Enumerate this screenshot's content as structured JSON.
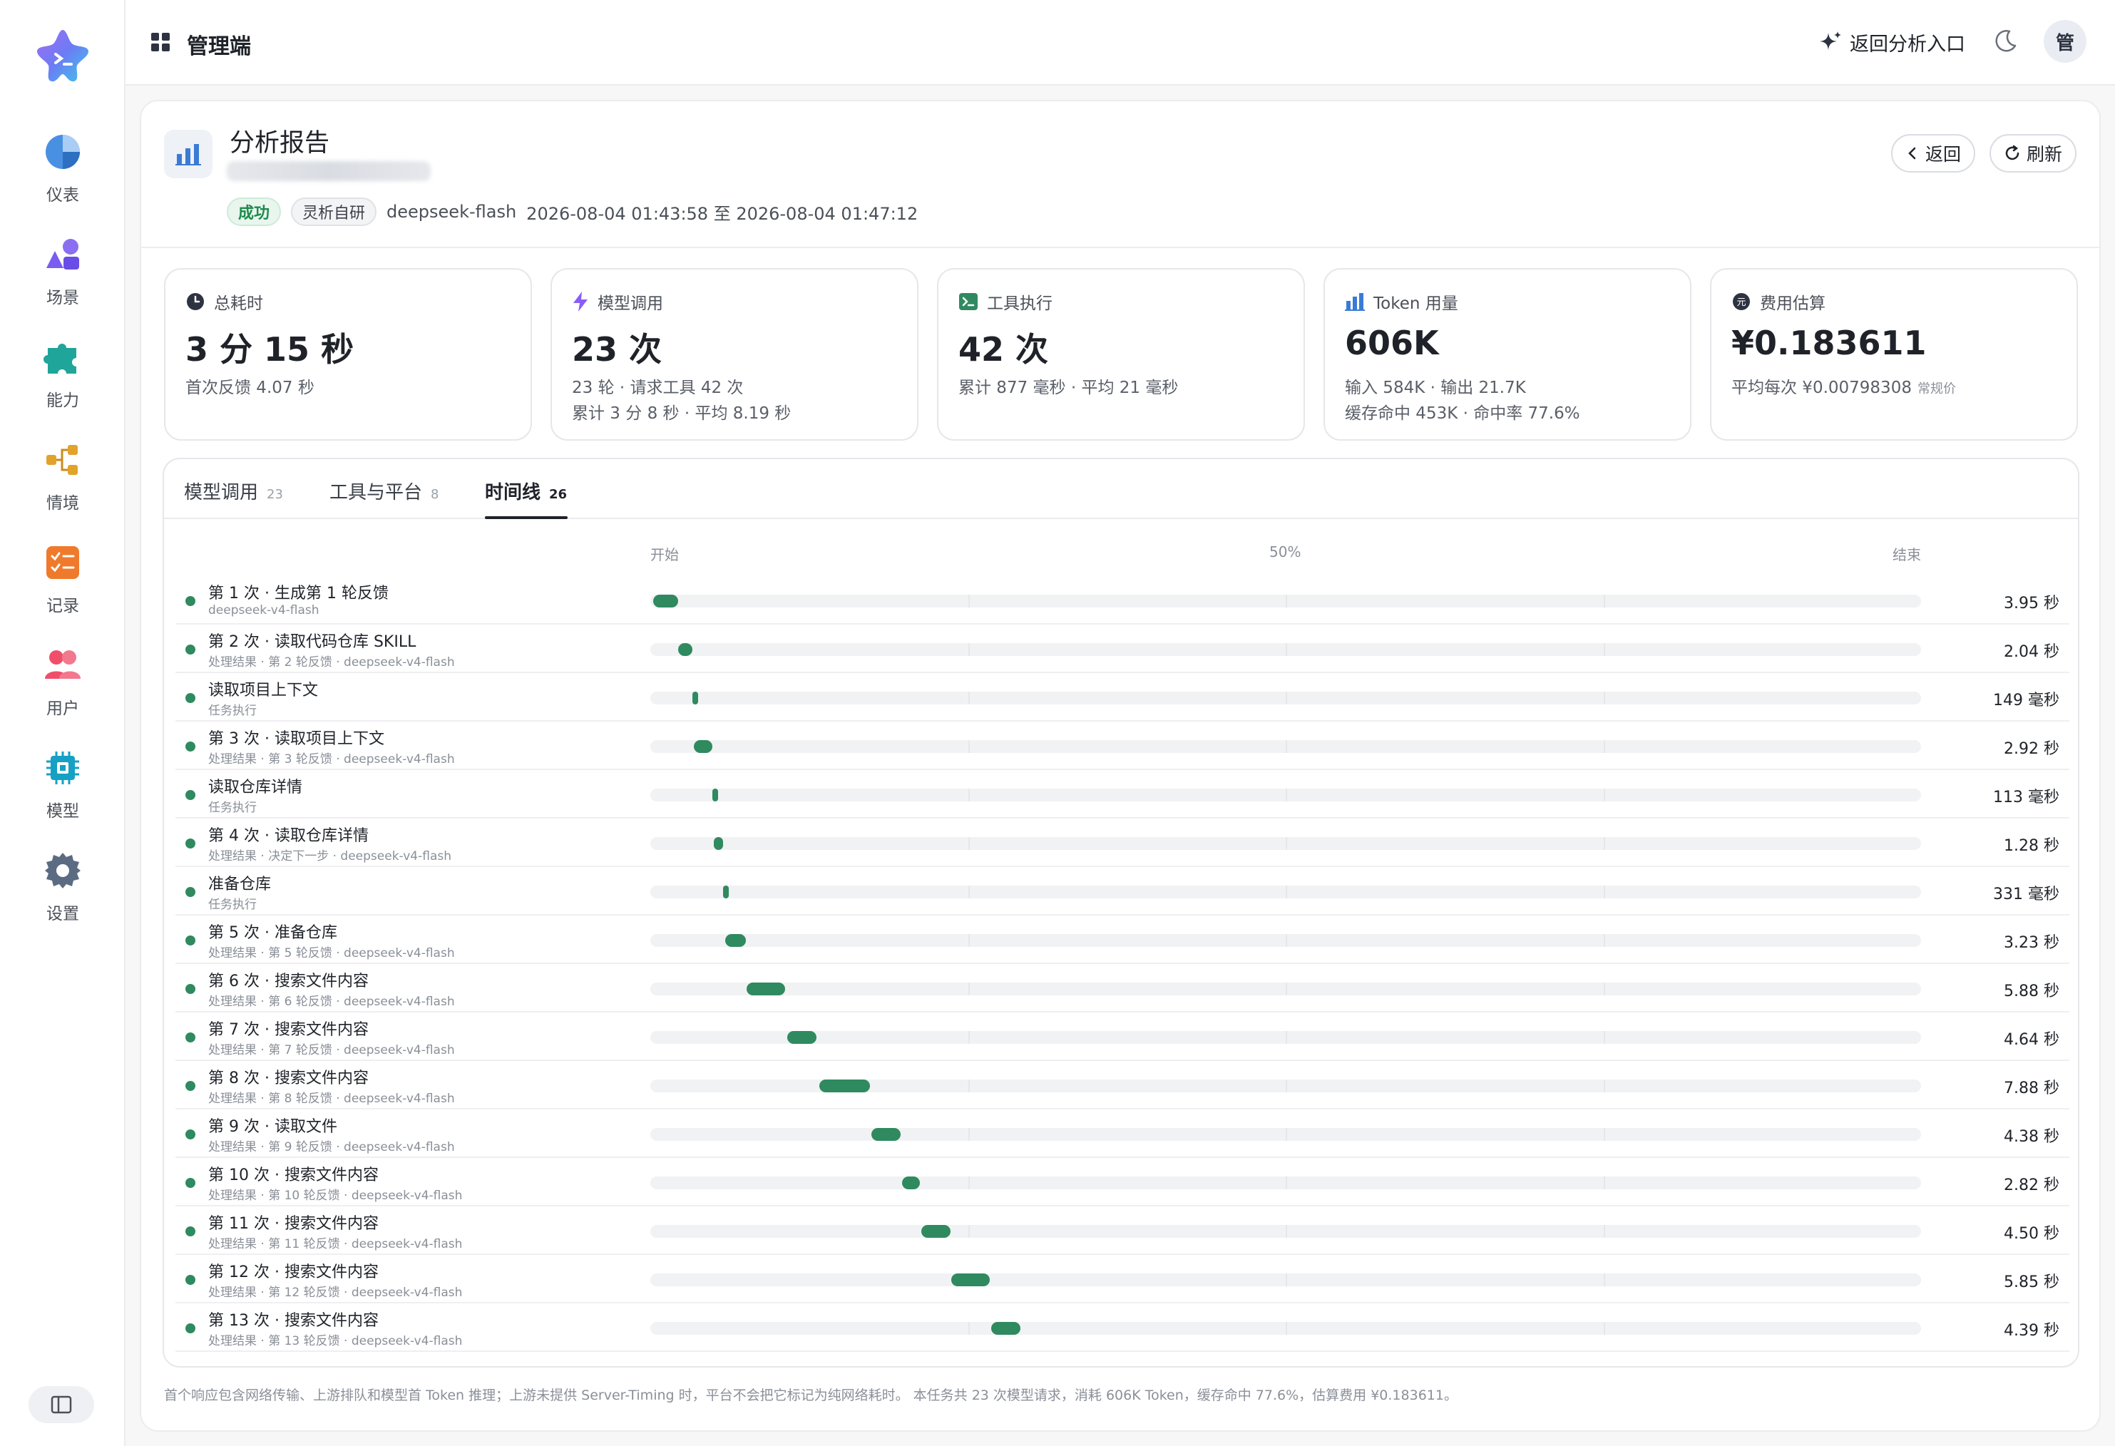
{
  "app": {
    "title": "管理端",
    "back_entry": "返回分析入口",
    "avatar": "管"
  },
  "sidebar": {
    "items": [
      {
        "label": "仪表",
        "icon": "pie-chart-icon"
      },
      {
        "label": "场景",
        "icon": "shapes-icon"
      },
      {
        "label": "能力",
        "icon": "puzzle-icon"
      },
      {
        "label": "情境",
        "icon": "flow-icon"
      },
      {
        "label": "记录",
        "icon": "checklist-icon"
      },
      {
        "label": "用户",
        "icon": "users-icon"
      },
      {
        "label": "模型",
        "icon": "chip-icon"
      },
      {
        "label": "设置",
        "icon": "gear-icon"
      }
    ]
  },
  "report": {
    "title": "分析报告",
    "status": "成功",
    "source": "灵析自研",
    "model": "deepseek-flash",
    "time_range": "2026-08-04 01:43:58 至 2026-08-04 01:47:12",
    "back_label": "返回",
    "refresh_label": "刷新"
  },
  "stats": [
    {
      "title": "总耗时",
      "value": "3 分 15 秒",
      "line1": "首次反馈 4.07 秒",
      "line2": ""
    },
    {
      "title": "模型调用",
      "value": "23 次",
      "line1": "23 轮 · 请求工具 42 次",
      "line2": "累计 3 分 8 秒 · 平均 8.19 秒"
    },
    {
      "title": "工具执行",
      "value": "42 次",
      "line1": "累计 877 毫秒 · 平均 21 毫秒",
      "line2": ""
    },
    {
      "title": "Token 用量",
      "value": "606K",
      "line1": "输入 584K · 输出 21.7K",
      "line2": "缓存命中 453K · 命中率 77.6%"
    },
    {
      "title": "费用估算",
      "value": "¥0.183611",
      "line1": "平均每次 ¥0.00798308",
      "line1_small": "常规价",
      "line2": ""
    }
  ],
  "tabs": [
    {
      "label": "模型调用",
      "count": "23"
    },
    {
      "label": "工具与平台",
      "count": "8"
    },
    {
      "label": "时间线",
      "count": "26"
    }
  ],
  "axis": {
    "start": "开始",
    "mid": "50%",
    "end": "结束"
  },
  "timeline": [
    {
      "name": "第 1 次 · 生成第 1 轮反馈",
      "sub": "deepseek-v4-flash",
      "start": 0.002,
      "end": 0.022,
      "duration": "3.95 秒"
    },
    {
      "name": "第 2 次 · 读取代码仓库 SKILL",
      "sub": "处理结果 · 第 2 轮反馈 · deepseek-v4-flash",
      "start": 0.022,
      "end": 0.033,
      "duration": "2.04 秒"
    },
    {
      "name": "读取项目上下文",
      "sub": "任务执行",
      "start": 0.033,
      "end": 0.037,
      "duration": "149 毫秒"
    },
    {
      "name": "第 3 次 · 读取项目上下文",
      "sub": "处理结果 · 第 3 轮反馈 · deepseek-v4-flash",
      "start": 0.034,
      "end": 0.049,
      "duration": "2.92 秒"
    },
    {
      "name": "读取仓库详情",
      "sub": "任务执行",
      "start": 0.049,
      "end": 0.053,
      "duration": "113 毫秒"
    },
    {
      "name": "第 4 次 · 读取仓库详情",
      "sub": "处理结果 · 决定下一步 · deepseek-v4-flash",
      "start": 0.05,
      "end": 0.057,
      "duration": "1.28 秒"
    },
    {
      "name": "准备仓库",
      "sub": "任务执行",
      "start": 0.057,
      "end": 0.062,
      "duration": "331 毫秒"
    },
    {
      "name": "第 5 次 · 准备仓库",
      "sub": "处理结果 · 第 5 轮反馈 · deepseek-v4-flash",
      "start": 0.059,
      "end": 0.075,
      "duration": "3.23 秒"
    },
    {
      "name": "第 6 次 · 搜索文件内容",
      "sub": "处理结果 · 第 6 轮反馈 · deepseek-v4-flash",
      "start": 0.076,
      "end": 0.106,
      "duration": "5.88 秒"
    },
    {
      "name": "第 7 次 · 搜索文件内容",
      "sub": "处理结果 · 第 7 轮反馈 · deepseek-v4-flash",
      "start": 0.108,
      "end": 0.131,
      "duration": "4.64 秒"
    },
    {
      "name": "第 8 次 · 搜索文件内容",
      "sub": "处理结果 · 第 8 轮反馈 · deepseek-v4-flash",
      "start": 0.133,
      "end": 0.173,
      "duration": "7.88 秒"
    },
    {
      "name": "第 9 次 · 读取文件",
      "sub": "处理结果 · 第 9 轮反馈 · deepseek-v4-flash",
      "start": 0.174,
      "end": 0.197,
      "duration": "4.38 秒"
    },
    {
      "name": "第 10 次 · 搜索文件内容",
      "sub": "处理结果 · 第 10 轮反馈 · deepseek-v4-flash",
      "start": 0.198,
      "end": 0.212,
      "duration": "2.82 秒"
    },
    {
      "name": "第 11 次 · 搜索文件内容",
      "sub": "处理结果 · 第 11 轮反馈 · deepseek-v4-flash",
      "start": 0.213,
      "end": 0.236,
      "duration": "4.50 秒"
    },
    {
      "name": "第 12 次 · 搜索文件内容",
      "sub": "处理结果 · 第 12 轮反馈 · deepseek-v4-flash",
      "start": 0.237,
      "end": 0.267,
      "duration": "5.85 秒"
    },
    {
      "name": "第 13 次 · 搜索文件内容",
      "sub": "处理结果 · 第 13 轮反馈 · deepseek-v4-flash",
      "start": 0.268,
      "end": 0.291,
      "duration": "4.39 秒"
    }
  ],
  "footnote": "首个响应包含网络传输、上游排队和模型首 Token 推理；上游未提供 Server-Timing 时，平台不会把它标记为纯网络耗时。 本任务共 23 次模型请求，消耗 606K Token，缓存命中 77.6%，估算费用 ¥0.183611。",
  "colors": {
    "accent": "#2f8a5f",
    "success": "#1f8a4c"
  }
}
